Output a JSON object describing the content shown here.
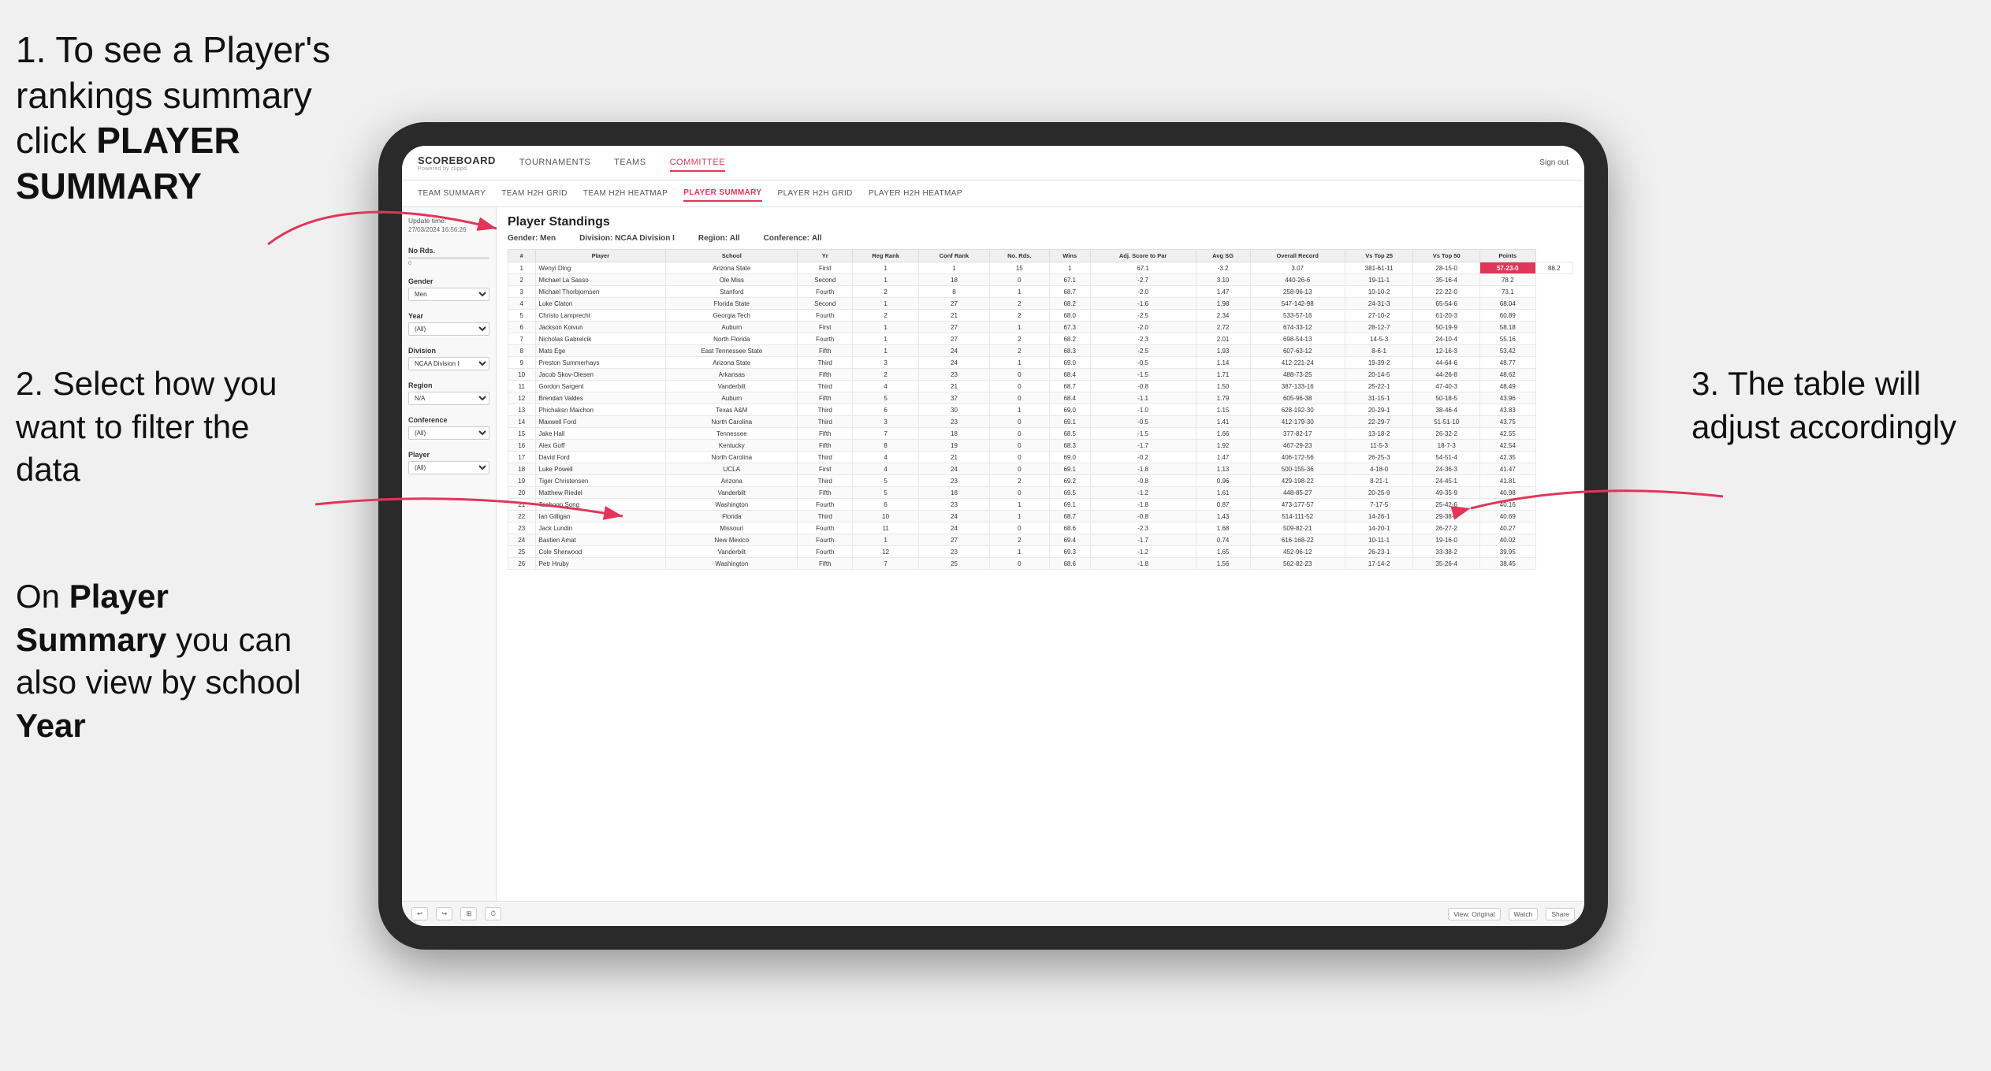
{
  "instructions": {
    "step1": "1. To see a Player's rankings summary click ",
    "step1_bold": "PLAYER SUMMARY",
    "step2_title": "2. Select how you want to filter the data",
    "step2_bottom": "On ",
    "step2_bottom_bold": "Player Summary",
    "step2_bottom_rest": " you can also view by school ",
    "step2_bottom_year": "Year",
    "step3": "3. The table will adjust accordingly"
  },
  "nav": {
    "logo": "SCOREBOARD",
    "logo_sub": "Powered by clippd",
    "items": [
      "TOURNAMENTS",
      "TEAMS",
      "COMMITTEE"
    ],
    "sign_out": "Sign out"
  },
  "sub_nav": {
    "items": [
      "TEAM SUMMARY",
      "TEAM H2H GRID",
      "TEAM H2H HEATMAP",
      "PLAYER SUMMARY",
      "PLAYER H2H GRID",
      "PLAYER H2H HEATMAP"
    ],
    "active": "PLAYER SUMMARY"
  },
  "sidebar": {
    "update_label": "Update time:",
    "update_time": "27/03/2024 16:56:26",
    "no_rds_label": "No Rds.",
    "gender_label": "Gender",
    "gender_value": "Men",
    "year_label": "Year",
    "year_value": "(All)",
    "division_label": "Division",
    "division_value": "NCAA Division I",
    "region_label": "Region",
    "region_value": "N/A",
    "conference_label": "Conference",
    "conference_value": "(All)",
    "player_label": "Player",
    "player_value": "(All)"
  },
  "table": {
    "title": "Player Standings",
    "filters": {
      "gender_label": "Gender:",
      "gender_val": "Men",
      "division_label": "Division:",
      "division_val": "NCAA Division I",
      "region_label": "Region:",
      "region_val": "All",
      "conference_label": "Conference:",
      "conference_val": "All"
    },
    "columns": [
      "#",
      "Player",
      "School",
      "Yr",
      "Reg Rank",
      "Conf Rank",
      "No. Rds.",
      "Wins",
      "Adj. Score to Par",
      "Avg SG",
      "Overall Record",
      "Vs Top 25",
      "Vs Top 50",
      "Points"
    ],
    "rows": [
      [
        "1",
        "Wenyi Ding",
        "Arizona State",
        "First",
        "1",
        "1",
        "15",
        "1",
        "67.1",
        "-3.2",
        "3.07",
        "381-61-11",
        "28-15-0",
        "57-23-0",
        "88.2"
      ],
      [
        "2",
        "Michael La Sasso",
        "Ole Miss",
        "Second",
        "1",
        "18",
        "0",
        "67.1",
        "-2.7",
        "3.10",
        "440-26-6",
        "19-11-1",
        "35-16-4",
        "78.2"
      ],
      [
        "3",
        "Michael Thorbjornsen",
        "Stanford",
        "Fourth",
        "2",
        "8",
        "1",
        "68.7",
        "-2.0",
        "1.47",
        "258-96-13",
        "10-10-2",
        "22-22-0",
        "73.1"
      ],
      [
        "4",
        "Luke Claton",
        "Florida State",
        "Second",
        "1",
        "27",
        "2",
        "68.2",
        "-1.6",
        "1.98",
        "547-142-98",
        "24-31-3",
        "65-54-6",
        "68.04"
      ],
      [
        "5",
        "Christo Lamprecht",
        "Georgia Tech",
        "Fourth",
        "2",
        "21",
        "2",
        "68.0",
        "-2.5",
        "2.34",
        "533-57-16",
        "27-10-2",
        "61-20-3",
        "60.89"
      ],
      [
        "6",
        "Jackson Koivun",
        "Auburn",
        "First",
        "1",
        "27",
        "1",
        "67.3",
        "-2.0",
        "2.72",
        "674-33-12",
        "28-12-7",
        "50-19-9",
        "58.18"
      ],
      [
        "7",
        "Nicholas Gabrelcik",
        "North Florida",
        "Fourth",
        "1",
        "27",
        "2",
        "68.2",
        "-2.3",
        "2.01",
        "698-54-13",
        "14-5-3",
        "24-10-4",
        "55.16"
      ],
      [
        "8",
        "Mats Ege",
        "East Tennessee State",
        "Fifth",
        "1",
        "24",
        "2",
        "68.3",
        "-2.5",
        "1.93",
        "607-63-12",
        "8-6-1",
        "12-16-3",
        "53.42"
      ],
      [
        "9",
        "Preston Summerhays",
        "Arizona State",
        "Third",
        "3",
        "24",
        "1",
        "69.0",
        "-0.5",
        "1.14",
        "412-221-24",
        "19-39-2",
        "44-64-6",
        "48.77"
      ],
      [
        "10",
        "Jacob Skov-Olesen",
        "Arkansas",
        "Fifth",
        "2",
        "23",
        "0",
        "68.4",
        "-1.5",
        "1.71",
        "488-73-25",
        "20-14-5",
        "44-26-8",
        "48.62"
      ],
      [
        "11",
        "Gordon Sargent",
        "Vanderbilt",
        "Third",
        "4",
        "21",
        "0",
        "68.7",
        "-0.8",
        "1.50",
        "387-133-16",
        "25-22-1",
        "47-40-3",
        "48.49"
      ],
      [
        "12",
        "Brendan Valdes",
        "Auburn",
        "Fifth",
        "5",
        "37",
        "0",
        "68.4",
        "-1.1",
        "1.79",
        "605-96-38",
        "31-15-1",
        "50-18-5",
        "43.96"
      ],
      [
        "13",
        "Phichaksn Maichon",
        "Texas A&M",
        "Third",
        "6",
        "30",
        "1",
        "69.0",
        "-1.0",
        "1.15",
        "628-192-30",
        "20-29-1",
        "38-46-4",
        "43.83"
      ],
      [
        "14",
        "Maxwell Ford",
        "North Carolina",
        "Third",
        "3",
        "23",
        "0",
        "69.1",
        "-0.5",
        "1.41",
        "412-179-30",
        "22-29-7",
        "51-51-10",
        "43.75"
      ],
      [
        "15",
        "Jake Hall",
        "Tennessee",
        "Fifth",
        "7",
        "18",
        "0",
        "68.5",
        "-1.5",
        "1.66",
        "377-82-17",
        "13-18-2",
        "26-32-2",
        "42.55"
      ],
      [
        "16",
        "Alex Goff",
        "Kentucky",
        "Fifth",
        "8",
        "19",
        "0",
        "68.3",
        "-1.7",
        "1.92",
        "467-29-23",
        "11-5-3",
        "18-7-3",
        "42.54"
      ],
      [
        "17",
        "David Ford",
        "North Carolina",
        "Third",
        "4",
        "21",
        "0",
        "69.0",
        "-0.2",
        "1.47",
        "406-172-56",
        "26-25-3",
        "54-51-4",
        "42.35"
      ],
      [
        "18",
        "Luke Powell",
        "UCLA",
        "First",
        "4",
        "24",
        "0",
        "69.1",
        "-1.8",
        "1.13",
        "500-155-36",
        "4-18-0",
        "24-36-3",
        "41.47"
      ],
      [
        "19",
        "Tiger Christensen",
        "Arizona",
        "Third",
        "5",
        "23",
        "2",
        "69.2",
        "-0.8",
        "0.96",
        "429-198-22",
        "8-21-1",
        "24-45-1",
        "41.81"
      ],
      [
        "20",
        "Matthew Riedel",
        "Vanderbilt",
        "Fifth",
        "5",
        "18",
        "0",
        "69.5",
        "-1.2",
        "1.61",
        "448-85-27",
        "20-25-9",
        "49-35-9",
        "40.98"
      ],
      [
        "21",
        "Taehoon Song",
        "Washington",
        "Fourth",
        "6",
        "23",
        "1",
        "69.1",
        "-1.8",
        "0.87",
        "473-177-57",
        "7-17-5",
        "25-42-6",
        "40.16"
      ],
      [
        "22",
        "Ian Gilligan",
        "Florida",
        "Third",
        "10",
        "24",
        "1",
        "68.7",
        "-0.8",
        "1.43",
        "514-111-52",
        "14-26-1",
        "29-38-2",
        "40.69"
      ],
      [
        "23",
        "Jack Lundin",
        "Missouri",
        "Fourth",
        "11",
        "24",
        "0",
        "68.6",
        "-2.3",
        "1.68",
        "509-82-21",
        "14-20-1",
        "26-27-2",
        "40.27"
      ],
      [
        "24",
        "Bastien Amat",
        "New Mexico",
        "Fourth",
        "1",
        "27",
        "2",
        "69.4",
        "-1.7",
        "0.74",
        "616-168-22",
        "10-11-1",
        "19-16-0",
        "40.02"
      ],
      [
        "25",
        "Cole Sherwood",
        "Vanderbilt",
        "Fourth",
        "12",
        "23",
        "1",
        "69.3",
        "-1.2",
        "1.65",
        "452-96-12",
        "26-23-1",
        "33-38-2",
        "39.95"
      ],
      [
        "26",
        "Petr Hruby",
        "Washington",
        "Fifth",
        "7",
        "25",
        "0",
        "68.6",
        "-1.8",
        "1.56",
        "562-82-23",
        "17-14-2",
        "35-26-4",
        "38.45"
      ]
    ]
  },
  "toolbar": {
    "view_label": "View: Original",
    "watch_label": "Watch",
    "share_label": "Share"
  }
}
